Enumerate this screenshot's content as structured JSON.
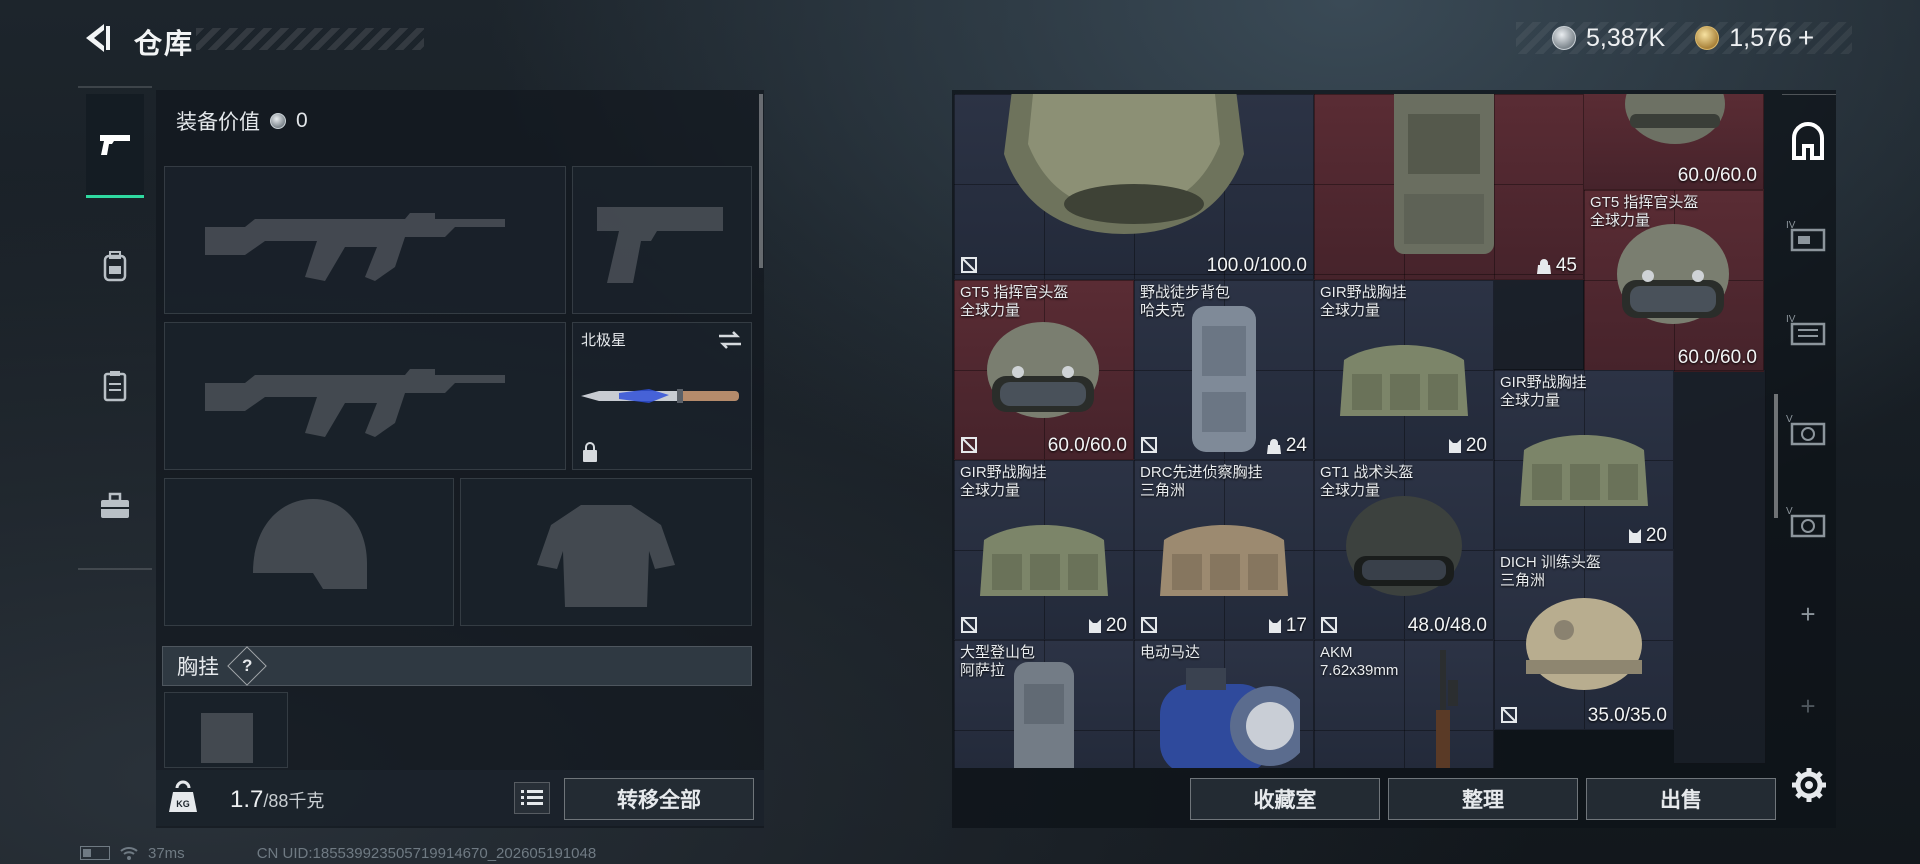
{
  "header": {
    "title": "仓库",
    "currency": [
      {
        "name": "hafu-coin",
        "value": "5,387K"
      },
      {
        "name": "delta-coin",
        "value": "1,576"
      }
    ],
    "add_symbol": "+"
  },
  "left_tabs": [
    {
      "name": "weapons",
      "icon": "pistol-icon",
      "active": true
    },
    {
      "name": "equipment",
      "icon": "backpack-icon",
      "active": false
    },
    {
      "name": "chest-rig",
      "icon": "vest-icon",
      "active": false
    },
    {
      "name": "items",
      "icon": "toolbox-icon",
      "active": false
    }
  ],
  "loadout": {
    "equip_value_label": "装备价值",
    "equip_value": "0",
    "melee_name": "北极星",
    "chest_rig_label": "胸挂",
    "help_symbol": "?",
    "weight_value": "1.7",
    "weight_capacity": "/88千克",
    "transfer_all_label": "转移全部"
  },
  "stash": {
    "items": [
      {
        "name": "",
        "sub": "",
        "value": "100.0/100.0",
        "color": "blue",
        "stat": "durability"
      },
      {
        "name": "",
        "sub": "",
        "value": "45",
        "color": "red",
        "stat": "capacity"
      },
      {
        "name": "",
        "sub": "",
        "value": "60.0/60.0",
        "color": "red",
        "stat": "durability"
      },
      {
        "name": "GT5 指挥官头盔",
        "sub": "全球力量",
        "value": "60.0/60.0",
        "color": "red",
        "stat": "durability"
      },
      {
        "name": "GT5 指挥官头盔",
        "sub": "全球力量",
        "value": "60.0/60.0",
        "color": "red",
        "stat": "durability"
      },
      {
        "name": "野战徒步背包",
        "sub": "哈夫克",
        "value": "24",
        "color": "blue",
        "stat": "capacity"
      },
      {
        "name": "GIR野战胸挂",
        "sub": "全球力量",
        "value": "20",
        "color": "blue",
        "stat": "slots"
      },
      {
        "name": "GIR野战胸挂",
        "sub": "全球力量",
        "value": "20",
        "color": "blue",
        "stat": "slots"
      },
      {
        "name": "GIR野战胸挂",
        "sub": "全球力量",
        "value": "20",
        "color": "blue",
        "stat": "slots"
      },
      {
        "name": "DRC先进侦察胸挂",
        "sub": "三角洲",
        "value": "17",
        "color": "blue",
        "stat": "slots"
      },
      {
        "name": "GT1 战术头盔",
        "sub": "全球力量",
        "value": "48.0/48.0",
        "color": "blue",
        "stat": "durability"
      },
      {
        "name": "DICH 训练头盔",
        "sub": "三角洲",
        "value": "35.0/35.0",
        "color": "blue",
        "stat": "durability"
      },
      {
        "name": "大型登山包",
        "sub": "阿萨拉",
        "value": "",
        "color": "blue",
        "stat": ""
      },
      {
        "name": "电动马达",
        "sub": "",
        "value": "",
        "color": "blue",
        "stat": ""
      },
      {
        "name": "AKM",
        "sub": "7.62x39mm",
        "value": "",
        "color": "blue",
        "stat": ""
      }
    ]
  },
  "right_tabs": [
    {
      "name": "main-stash",
      "icon": "stash-home-icon",
      "active": true
    },
    {
      "name": "stash-iv-1",
      "icon": "stash-iv-icon",
      "badge": "IV"
    },
    {
      "name": "stash-iv-2",
      "icon": "stash-iv-icon",
      "badge": "IV"
    },
    {
      "name": "stash-v-1",
      "icon": "stash-v-icon",
      "badge": "V"
    },
    {
      "name": "stash-v-2",
      "icon": "stash-v-icon",
      "badge": "V"
    },
    {
      "name": "add-1",
      "icon": "plus-icon",
      "label": "+"
    },
    {
      "name": "add-2",
      "icon": "plus-icon",
      "label": "+"
    }
  ],
  "bottom_actions": {
    "collection_label": "收藏室",
    "organize_label": "整理",
    "sell_label": "出售"
  },
  "status": {
    "ping": "37ms",
    "uid": "CN UID:18553992350571991467​0_202605191048"
  },
  "colors": {
    "accent": "#2fd9a0",
    "item_red": "#5a2c34",
    "item_blue": "#2c3345"
  }
}
